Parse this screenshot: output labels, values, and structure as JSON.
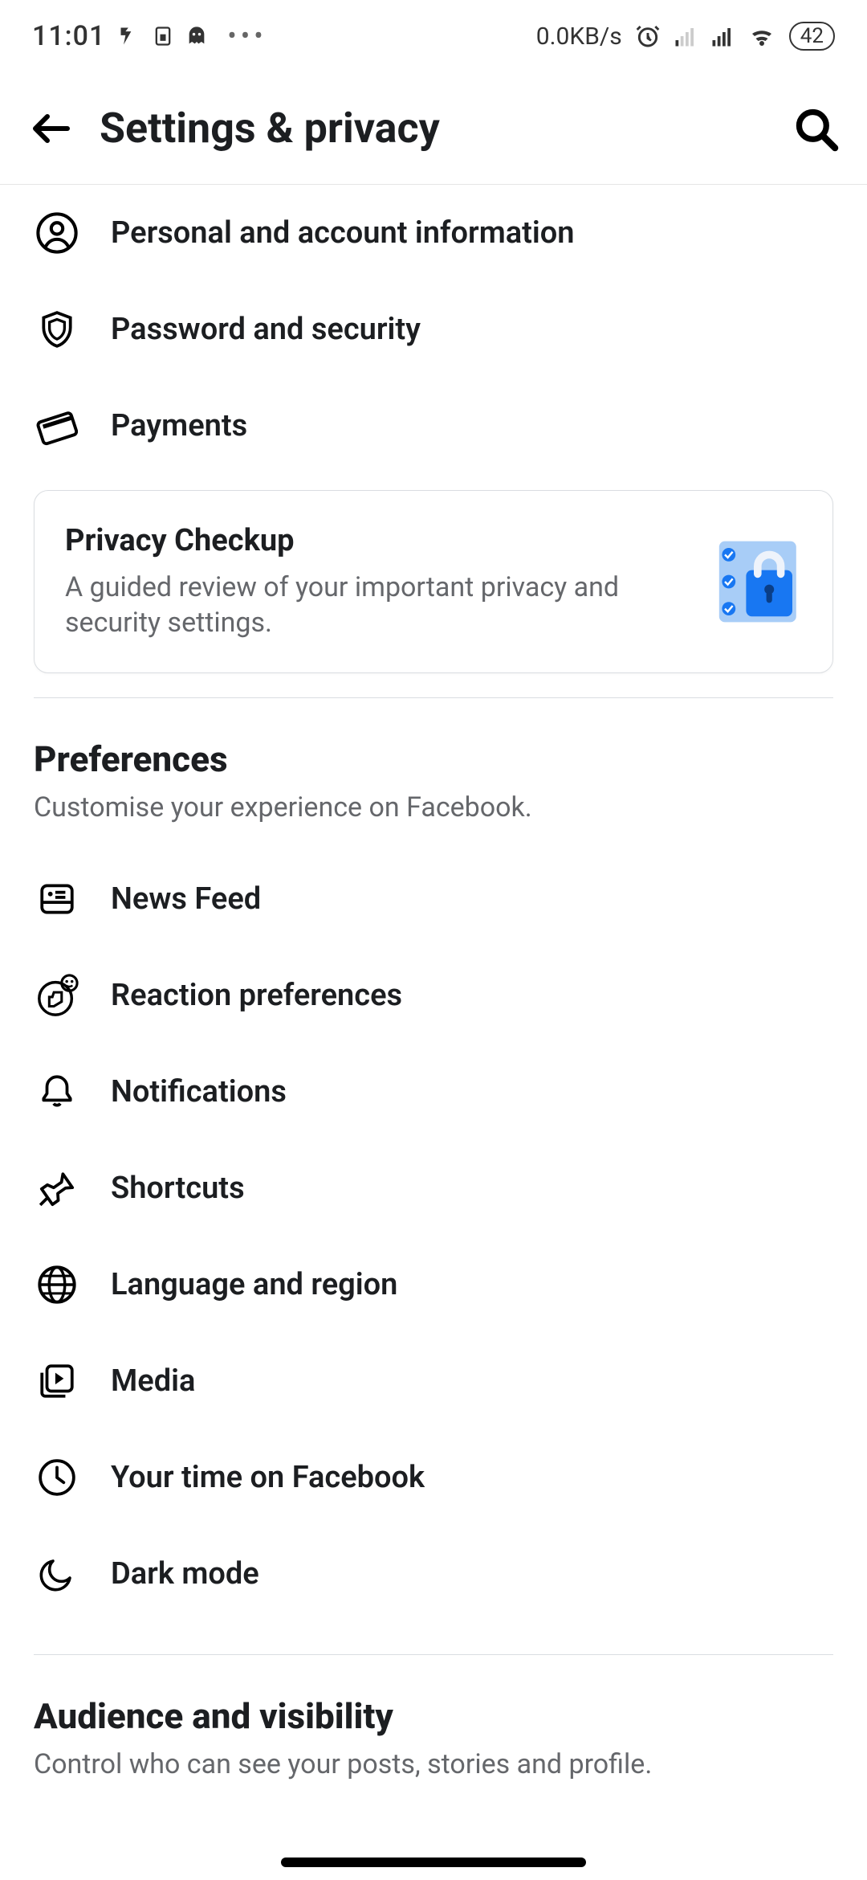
{
  "statusbar": {
    "time": "11:01",
    "data_rate": "0.0KB/s",
    "battery": "42"
  },
  "header": {
    "title": "Settings & privacy"
  },
  "account_rows": [
    {
      "icon": "person-circle-icon",
      "label": "Personal and account information"
    },
    {
      "icon": "shield-icon",
      "label": "Password and security"
    },
    {
      "icon": "card-icon",
      "label": "Payments"
    }
  ],
  "privacy_card": {
    "title": "Privacy Checkup",
    "description": "A guided review of your important privacy and security settings."
  },
  "sections": [
    {
      "title": "Preferences",
      "description": "Customise your experience on Facebook.",
      "rows": [
        {
          "icon": "news-feed-icon",
          "label": "News Feed"
        },
        {
          "icon": "reaction-icon",
          "label": "Reaction preferences"
        },
        {
          "icon": "bell-icon",
          "label": "Notifications"
        },
        {
          "icon": "pin-icon",
          "label": "Shortcuts"
        },
        {
          "icon": "globe-icon",
          "label": "Language and region"
        },
        {
          "icon": "media-icon",
          "label": "Media"
        },
        {
          "icon": "clock-icon",
          "label": "Your time on Facebook"
        },
        {
          "icon": "moon-icon",
          "label": "Dark mode"
        }
      ]
    },
    {
      "title": "Audience and visibility",
      "description": "Control who can see your posts, stories and profile.",
      "rows": []
    }
  ]
}
